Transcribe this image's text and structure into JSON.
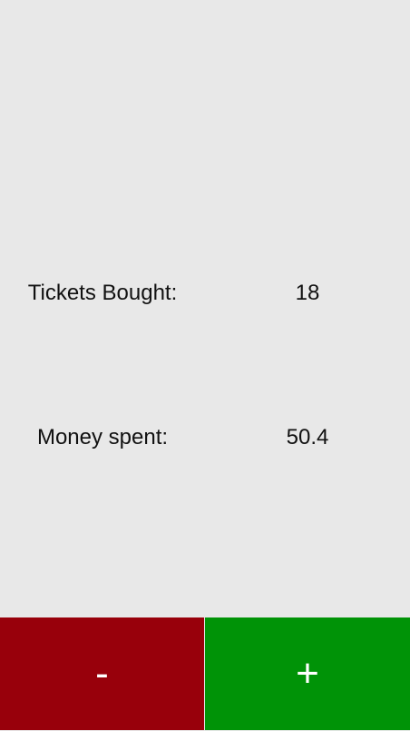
{
  "stats": {
    "tickets_label": "Tickets Bought:",
    "tickets_value": "18",
    "money_label": "Money spent:",
    "money_value": "50.4"
  },
  "buttons": {
    "decrement_label": "-",
    "increment_label": "+",
    "decrement_color": "#98000b",
    "increment_color": "#009307"
  },
  "colors": {
    "background": "#e8e8e8",
    "text": "#111111",
    "button_text": "#ffffff"
  }
}
